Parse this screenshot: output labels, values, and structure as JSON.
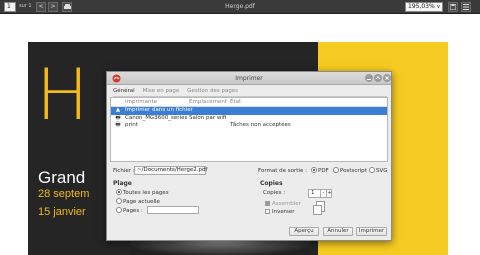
{
  "viewer": {
    "page_number": "1",
    "page_of": "sur 1",
    "title": "Herge.pdf",
    "zoom": "195,03%",
    "prev_glyph": "<",
    "next_glyph": ">",
    "zoom_arrow": "v"
  },
  "poster": {
    "big_letter": "H",
    "heading": "Grand",
    "date_line_1": "28 septem",
    "date_line_2": "15 janvier"
  },
  "dialog": {
    "title": "Imprimer",
    "tabs": [
      "Général",
      "Mise en page",
      "Gestion des pages"
    ],
    "printer_list": {
      "headers": [
        "Imprimante",
        "Emplacement",
        "État"
      ],
      "rows": [
        {
          "icon": "file-icon",
          "name": "Imprimer dans un fichier",
          "location": "",
          "state": "",
          "selected": true
        },
        {
          "icon": "printer-icon",
          "name": "Canon_MG3600_series",
          "location": "Salon par wifi",
          "state": "",
          "selected": false
        },
        {
          "icon": "printer-icon",
          "name": "print",
          "location": "",
          "state": "Tâches non acceptées",
          "selected": false
        }
      ]
    },
    "file_label": "Fichier :",
    "file_value": "~/Documents/Herge2.pdf",
    "format_label": "Format de sortie :",
    "formats": [
      {
        "label": "PDF",
        "selected": true
      },
      {
        "label": "Postscript",
        "selected": false
      },
      {
        "label": "SVG",
        "selected": false
      }
    ],
    "range_title": "Plage",
    "range_options": [
      {
        "label": "Toutes les pages",
        "selected": true
      },
      {
        "label": "Page actuelle",
        "selected": false
      },
      {
        "label": "Pages :",
        "selected": false
      }
    ],
    "copies_title": "Copies",
    "copies_label": "Copies :",
    "copies_value": "1",
    "collate_label": "Assembler",
    "reverse_label": "Inverser",
    "buttons": {
      "preview": "Aperçu",
      "cancel": "Annuler",
      "print": "Imprimer"
    }
  },
  "colors": {
    "accent": "#3b7fd4",
    "poster_yellow": "#f7cc22",
    "poster_dark": "#252525"
  }
}
